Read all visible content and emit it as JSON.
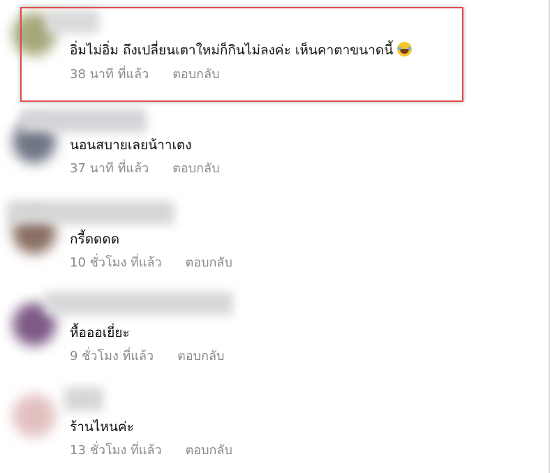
{
  "comments": [
    {
      "text": "อิ่มไม่อิ่ม ถึงเปลี่ยนเตาใหม่ก็กินไม่ลงค่ะ เห็นคาตาขนาดนี้",
      "emoji": "face-with-tears-of-joy",
      "time": "38 นาที ที่แล้ว",
      "reply": "ตอบกลับ",
      "highlighted": true
    },
    {
      "text": "นอนสบายเลยน้าาเตง",
      "time": "37 นาที ที่แล้ว",
      "reply": "ตอบกลับ"
    },
    {
      "text": "กรี้ดดดด",
      "time": "10 ชั่วโมง ที่แล้ว",
      "reply": "ตอบกลับ"
    },
    {
      "text": "หื้อออเยี่ยะ",
      "time": "9 ชั่วโมง ที่แล้ว",
      "reply": "ตอบกลับ"
    },
    {
      "text": "ร้านไหนค่ะ",
      "time": "13 ชั่วโมง ที่แล้ว",
      "reply": "ตอบกลับ"
    }
  ],
  "colors": {
    "highlight_border": "#e24a4a",
    "meta_text": "#8a8a8a",
    "comment_text": "#101010"
  }
}
